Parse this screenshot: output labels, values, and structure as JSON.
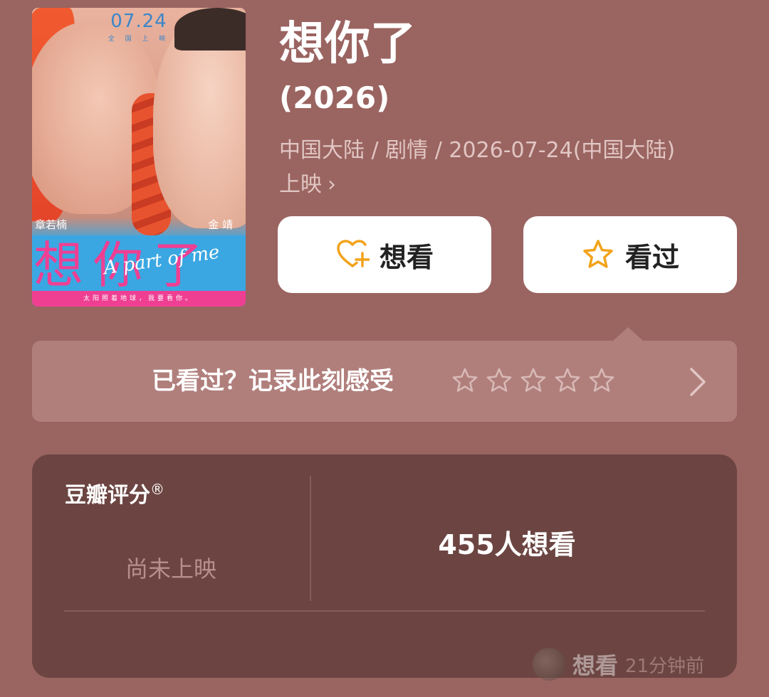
{
  "poster": {
    "date": "07.24",
    "date_sub": "全 国 上 映",
    "actor_left": "章若楠",
    "actor_right": "金 靖",
    "title_cn": "想你了",
    "title_en": "A part of me",
    "tagline": "太阳照着地球，我要看你。"
  },
  "movie": {
    "title": "想你了",
    "year": "(2026)",
    "meta_line": "中国大陆 / 剧情 / 2026-07-24(中国大陆)",
    "release_link": "上映",
    "chevron": "›"
  },
  "actions": {
    "want_label": "想看",
    "seen_label": "看过",
    "want_icon": "heart-plus-icon",
    "seen_icon": "star-icon",
    "icon_color": "#f2a31b"
  },
  "rate_bar": {
    "prompt": "已看过？记录此刻感受",
    "stars": 5,
    "rating": 0
  },
  "rating_panel": {
    "label": "豆瓣评分",
    "label_mark": "®",
    "status": "尚未上映",
    "want_count": "455人想看"
  },
  "activity": {
    "verb": "想看",
    "time": "21分钟前"
  },
  "colors": {
    "background": "#9a6461",
    "panel": "#6c4542",
    "rate_bar": "#b07f7c"
  }
}
